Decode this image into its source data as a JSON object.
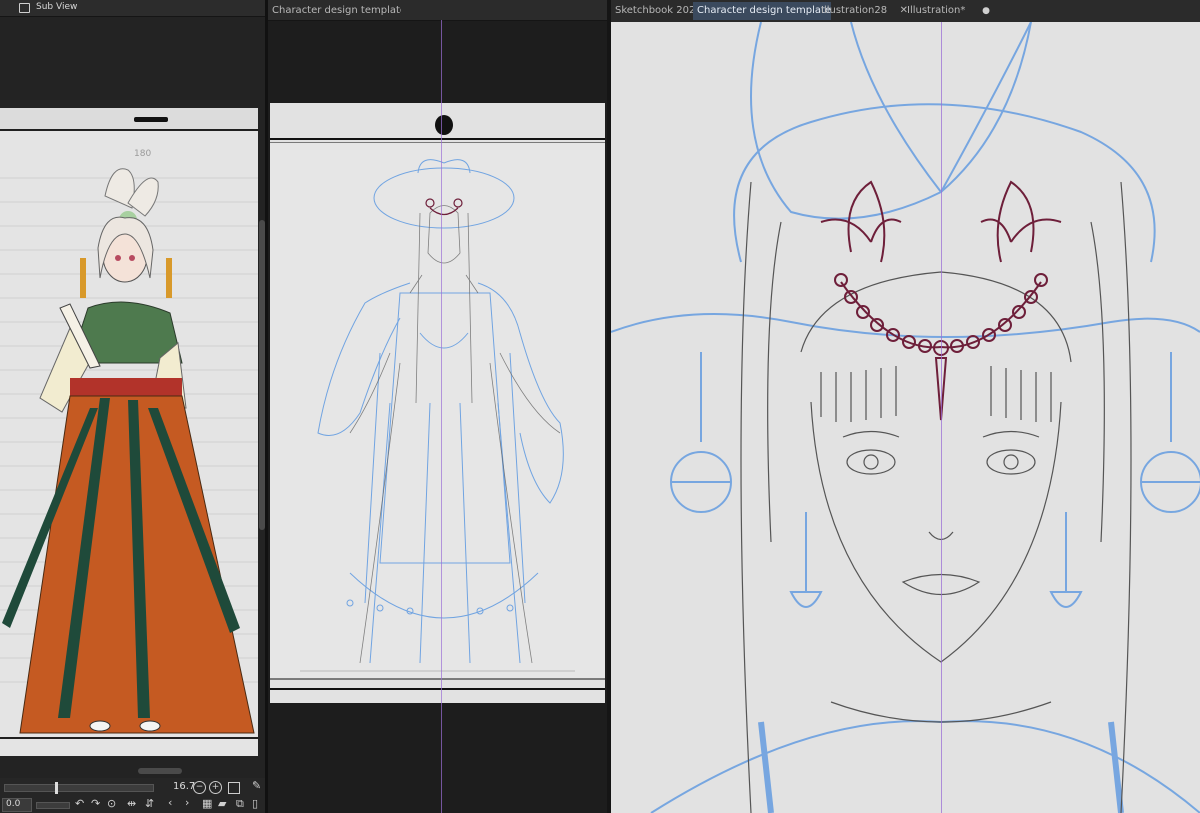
{
  "subview": {
    "title": "Sub View",
    "ruler_value": "180",
    "zoom_value": "16.7",
    "rotation_value": "0.0"
  },
  "middle_tabs": [
    {
      "label": "Character design template*",
      "modified_dot": "●"
    }
  ],
  "right_tabs": [
    {
      "label": "Sketchbook 202",
      "close": ""
    },
    {
      "label": "Character design template*",
      "close": "●"
    },
    {
      "label": "Illustration28",
      "close": "✕"
    },
    {
      "label": "Illustration*",
      "close": "●"
    }
  ],
  "colors": {
    "app_bg": "#1e1e1e",
    "canvas_bg": "#e2e2e2",
    "sketch_blue": "#4a8ee0",
    "line_gray": "#555555",
    "accent_purple": "#6e1f3a",
    "guide_purple": "#9b6fd6",
    "skirt_orange": "#c55a22",
    "top_green": "#4e7a4e",
    "sash_green": "#1f4a3a"
  },
  "icons": {
    "subview_icon": "subview-window-icon",
    "zoom_out": "minus-circle-icon",
    "zoom_in": "plus-circle-icon",
    "fit": "fit-view-icon",
    "eyedropper": "eyedropper-icon",
    "rotate_left": "rotate-left-icon",
    "rotate_right": "rotate-right-icon",
    "reset_rotation": "reset-rotation-icon",
    "flip_h": "flip-horizontal-icon",
    "flip_v": "flip-vertical-icon",
    "prev": "chevron-left-icon",
    "next": "chevron-right-icon",
    "grid": "grid-icon",
    "open_folder": "open-folder-icon",
    "import": "import-icon",
    "delete": "trash-icon"
  }
}
